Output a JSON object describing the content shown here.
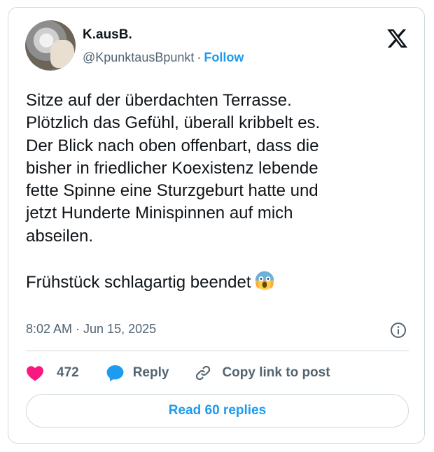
{
  "author": {
    "name": "K.ausB.",
    "handle": "@KpunktausBpunkt",
    "separator": "·",
    "follow_label": "Follow",
    "avatar_icon": "avatar-photo",
    "platform_icon": "x-logo-icon"
  },
  "post": {
    "text": "Sitze auf der überdachten Terrasse.\nPlötzlich das Gefühl, überall kribbelt es.\nDer Blick nach oben offenbart, dass die\nbisher in friedlicher Koexistenz lebende\nfette Spinne eine Sturzgeburt hatte und\njetzt Hunderte Minispinnen auf mich\nabseilen.\n\nFrühstück schlagartig beendet",
    "emoji": "screaming-face-emoji",
    "timestamp": "8:02 AM · Jun 15, 2025"
  },
  "actions": {
    "likes": "472",
    "reply_label": "Reply",
    "copy_label": "Copy link to post"
  },
  "read_replies_label": "Read 60 replies",
  "colors": {
    "accent": "#1d9bf0",
    "like": "#f91880",
    "text": "#0f1419",
    "muted": "#536471",
    "border": "#cfd9de"
  }
}
